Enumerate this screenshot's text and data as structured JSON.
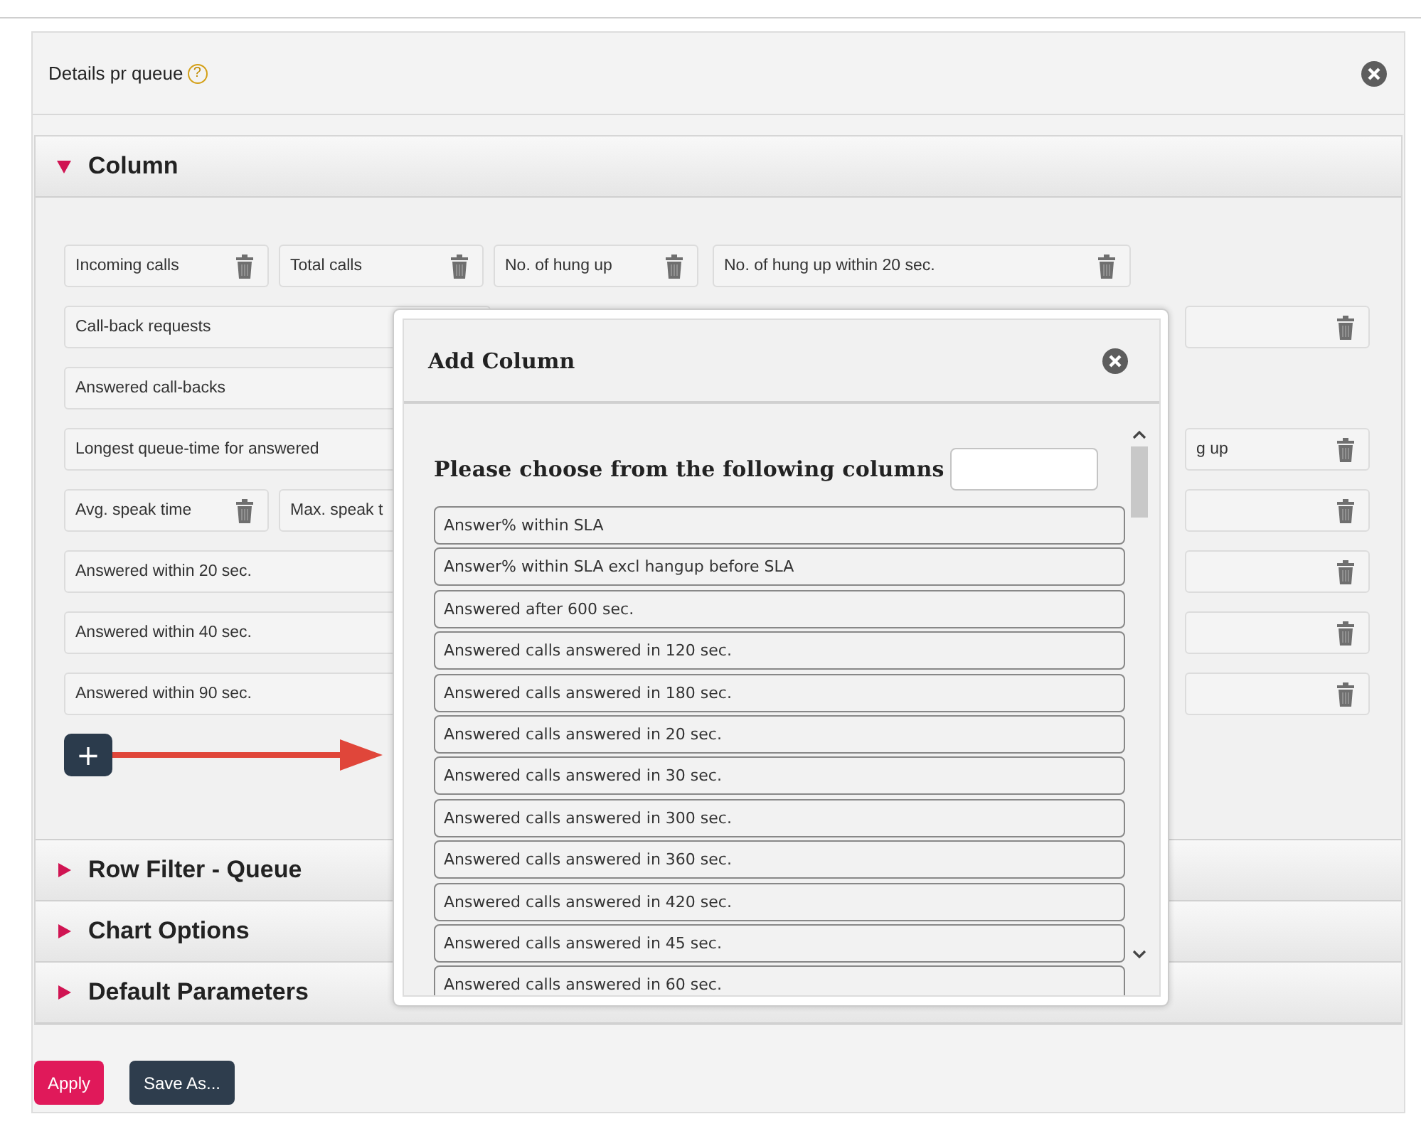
{
  "panel": {
    "title": "Details pr queue",
    "help": "?"
  },
  "sections": [
    {
      "title": "Column",
      "expanded": true
    },
    {
      "title": "Row Filter - Queue",
      "expanded": false
    },
    {
      "title": "Chart Options",
      "expanded": false
    },
    {
      "title": "Default Parameters",
      "expanded": false
    }
  ],
  "column_rows": [
    {
      "left": [
        {
          "label": "Incoming calls",
          "delete_icon": true
        },
        {
          "label": "Total calls",
          "delete_icon": true
        },
        {
          "label": "No. of hung up",
          "delete_icon": true
        },
        {
          "label": "No. of hung up within 20 sec.",
          "delete_icon": true
        }
      ],
      "right": []
    },
    {
      "left": [
        {
          "label": "Call-back requests",
          "delete_icon": false
        }
      ],
      "right": [
        {
          "delete_icon": true
        }
      ]
    },
    {
      "left": [
        {
          "label": "Answered call-backs",
          "delete_icon": false
        }
      ],
      "right": []
    },
    {
      "left": [
        {
          "label": "Longest queue-time for answered",
          "delete_icon": false
        }
      ],
      "right": [
        {
          "label": "g up",
          "delete_icon": true
        }
      ]
    },
    {
      "left": [
        {
          "label": "Avg. speak time",
          "delete_icon": true
        },
        {
          "label": "Max. speak t",
          "delete_icon": false
        }
      ],
      "right": [
        {
          "delete_icon": true
        }
      ]
    },
    {
      "left": [
        {
          "label": "Answered within 20 sec.",
          "delete_icon": false
        }
      ],
      "right": [
        {
          "delete_icon": true
        }
      ]
    },
    {
      "left": [
        {
          "label": "Answered within 40 sec.",
          "delete_icon": false
        }
      ],
      "right": [
        {
          "delete_icon": true
        }
      ]
    },
    {
      "left": [
        {
          "label": "Answered within 90 sec.",
          "delete_icon": false
        }
      ],
      "right": [
        {
          "delete_icon": true
        }
      ]
    }
  ],
  "add_button": {
    "label": "+"
  },
  "buttons": [
    {
      "label": "Apply",
      "kind": "primary"
    },
    {
      "label": "Save As...",
      "kind": "secondary"
    }
  ],
  "dialog": {
    "title": "Add Column",
    "prompt": "Please choose from the following columns",
    "options": [
      "Answer% within SLA",
      "Answer% within SLA excl hangup before SLA",
      "Answered after 600 sec.",
      "Answered calls answered in 120 sec.",
      "Answered calls answered in 180 sec.",
      "Answered calls answered in 20 sec.",
      "Answered calls answered in 30 sec.",
      "Answered calls answered in 300 sec.",
      "Answered calls answered in 360 sec.",
      "Answered calls answered in 420 sec.",
      "Answered calls answered in 45 sec.",
      "Answered calls answered in 60 sec."
    ]
  }
}
